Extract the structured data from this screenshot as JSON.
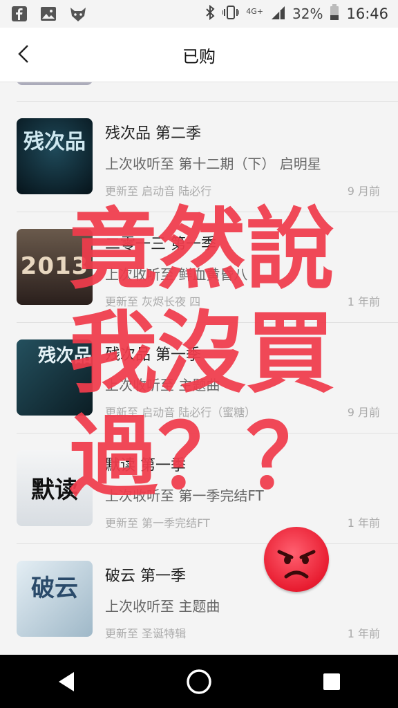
{
  "status_bar": {
    "icons": [
      "facebook-icon",
      "gallery-icon",
      "fox-app-icon",
      "bluetooth-icon",
      "vibrate-icon",
      "signal-icon",
      "battery-icon"
    ],
    "network": "4G+",
    "battery": "32%",
    "time": "16:46"
  },
  "header": {
    "title": "已购",
    "back_icon": "chevron-left-icon"
  },
  "items": [
    {
      "title": "残次品 第二季",
      "last_listened": "上次收听至 第十二期（下） 启明星",
      "update": "更新至 启动音 陆必行",
      "time": "9 月前",
      "cover_text": "残次品",
      "cover_color": "#0f2a34"
    },
    {
      "title": "二零一三 第一季",
      "last_listened": "上次收听至 鲜血黄昏八",
      "update": "更新至 灰烬长夜 四",
      "time": "1 年前",
      "cover_text": "2013",
      "cover_color": "#3a2c2a"
    },
    {
      "title": "残次品 第一季",
      "last_listened": "上次收听至 主题曲",
      "update": "更新至 启动音 陆必行（蜜糖）",
      "time": "9 月前",
      "cover_text": "残次品",
      "cover_color": "#16303a"
    },
    {
      "title": "默读 第一季",
      "last_listened": "上次收听至 第一季完结FT",
      "update": "更新至 第一季完结FT",
      "time": "1 年前",
      "cover_text": "默读",
      "cover_color": "#e9ecef"
    },
    {
      "title": "破云 第一季",
      "last_listened": "上次收听至 主题曲",
      "update": "更新至 圣诞特辑",
      "time": "1 年前",
      "cover_text": "破云",
      "cover_color": "#cfe0ea"
    }
  ],
  "overlay": {
    "line1": "竟然說",
    "line2": "我沒買",
    "line3": "過？？",
    "emoji": "angry-face-icon",
    "color": "#f03c4c"
  },
  "nav_bar": {
    "icons": [
      "back-triangle-icon",
      "home-circle-icon",
      "recents-square-icon"
    ]
  }
}
